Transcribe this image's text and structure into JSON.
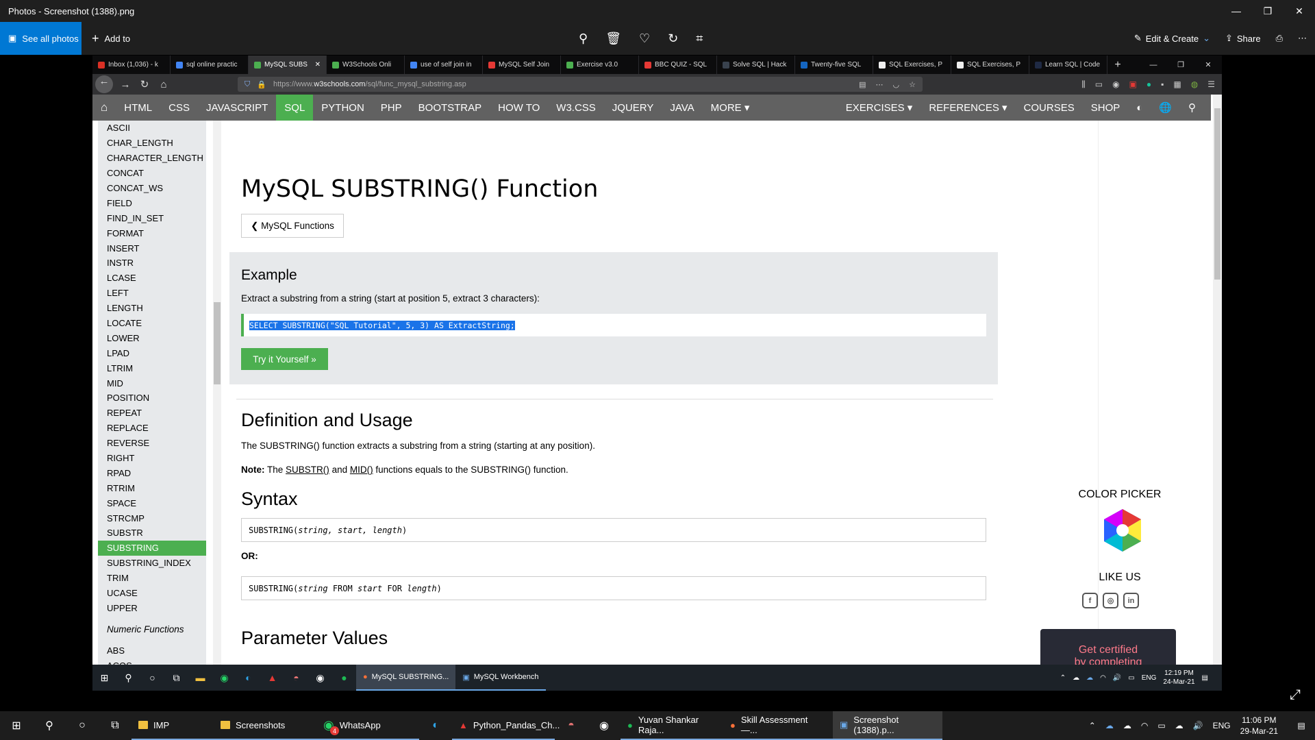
{
  "photos": {
    "window_title": "Photos - Screenshot (1388).png",
    "see_all": "See all photos",
    "add_to": "Add to",
    "edit_create": "Edit & Create",
    "share": "Share"
  },
  "browser": {
    "tabs": [
      {
        "label": "Inbox (1,036) - k",
        "color": "#d93025"
      },
      {
        "label": "sql online practic",
        "color": "#4285f4"
      },
      {
        "label": "MySQL SUBS",
        "color": "#4caf50",
        "active": true
      },
      {
        "label": "W3Schools Onli",
        "color": "#4caf50"
      },
      {
        "label": "use of self join in",
        "color": "#4285f4"
      },
      {
        "label": "MySQL Self Join",
        "color": "#e53935"
      },
      {
        "label": "Exercise v3.0",
        "color": "#4caf50"
      },
      {
        "label": "BBC QUIZ - SQL",
        "color": "#e53935"
      },
      {
        "label": "Solve SQL | Hack",
        "color": "#39424e"
      },
      {
        "label": "Twenty-five SQL",
        "color": "#1565c0"
      },
      {
        "label": "SQL Exercises, P",
        "color": "#eeeeee"
      },
      {
        "label": "SQL Exercises, P",
        "color": "#eeeeee"
      },
      {
        "label": "Learn SQL | Code",
        "color": "#1f2a44"
      }
    ],
    "url_prefix": "https://www.",
    "url_host": "w3schools.com",
    "url_path": "/sql/func_mysql_substring.asp"
  },
  "w3nav": {
    "items": [
      "HTML",
      "CSS",
      "JAVASCRIPT",
      "SQL",
      "PYTHON",
      "PHP",
      "BOOTSTRAP",
      "HOW TO",
      "W3.CSS",
      "JQUERY",
      "JAVA",
      "MORE ▾"
    ],
    "right": [
      "EXERCISES ▾",
      "REFERENCES ▾",
      "COURSES",
      "SHOP"
    ]
  },
  "sidebar": {
    "items": [
      "ASCII",
      "CHAR_LENGTH",
      "CHARACTER_LENGTH",
      "CONCAT",
      "CONCAT_WS",
      "FIELD",
      "FIND_IN_SET",
      "FORMAT",
      "INSERT",
      "INSTR",
      "LCASE",
      "LEFT",
      "LENGTH",
      "LOCATE",
      "LOWER",
      "LPAD",
      "LTRIM",
      "MID",
      "POSITION",
      "REPEAT",
      "REPLACE",
      "REVERSE",
      "RIGHT",
      "RPAD",
      "RTRIM",
      "SPACE",
      "STRCMP",
      "SUBSTR",
      "SUBSTRING",
      "SUBSTRING_INDEX",
      "TRIM",
      "UCASE",
      "UPPER"
    ],
    "active": "SUBSTRING",
    "section": "Numeric Functions",
    "section_items": [
      "ABS",
      "ACOS"
    ]
  },
  "main": {
    "title": "MySQL SUBSTRING() Function",
    "back_button": "❮ MySQL Functions",
    "example_heading": "Example",
    "example_desc": "Extract a substring from a string (start at position 5, extract 3 characters):",
    "example_code": "SELECT SUBSTRING(\"SQL Tutorial\", 5, 3) AS ExtractString;",
    "try_button": "Try it Yourself »",
    "def_heading": "Definition and Usage",
    "def_text": "The SUBSTRING() function extracts a substring from a string (starting at any position).",
    "note_label": "Note:",
    "note_pre": "The",
    "note_link1": "SUBSTR()",
    "note_and": "and",
    "note_link2": "MID()",
    "note_post": "functions equals to the SUBSTRING() function.",
    "syntax_heading": "Syntax",
    "syntax1_fn": "SUBSTRING(",
    "syntax1_args": "string, start, length",
    "syntax1_end": ")",
    "or_label": "OR:",
    "syntax2_fn": "SUBSTRING(",
    "syntax2_a": "string",
    "syntax2_from": " FROM ",
    "syntax2_b": "start",
    "syntax2_for": " FOR ",
    "syntax2_c": "length",
    "syntax2_end": ")",
    "param_heading": "Parameter Values"
  },
  "right": {
    "color_picker": "COLOR PICKER",
    "like_us": "LIKE US",
    "cert_line1": "Get certified",
    "cert_line2": "by completing"
  },
  "inner_taskbar": {
    "apps": [
      "MySQL SUBSTRING...",
      "MySQL Workbench"
    ],
    "lang": "ENG",
    "time": "12:19 PM",
    "date": "24-Mar-21"
  },
  "taskbar": {
    "apps": [
      "IMP",
      "Screenshots",
      "WhatsApp",
      "Python_Pandas_Ch...",
      "Yuvan Shankar Raja...",
      "Skill Assessment —...",
      "Screenshot (1388).p..."
    ],
    "whatsapp_badge": "4",
    "lang": "ENG",
    "time": "11:06 PM",
    "date": "29-Mar-21"
  }
}
